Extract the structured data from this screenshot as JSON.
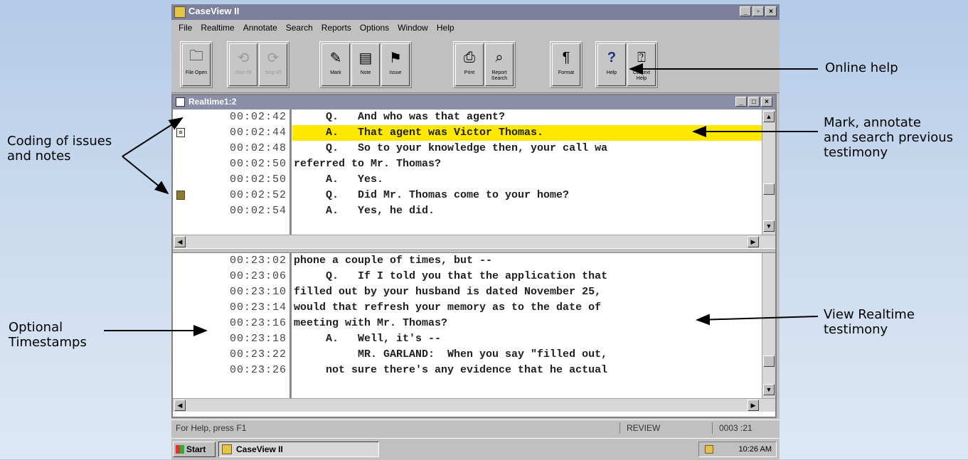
{
  "window": {
    "title": "CaseView II"
  },
  "menu": [
    "File",
    "Realtime",
    "Annotate",
    "Search",
    "Reports",
    "Options",
    "Window",
    "Help"
  ],
  "toolbar": {
    "groups": [
      [
        {
          "label": "File Open",
          "icon": "folder-open-icon",
          "enabled": true
        }
      ],
      [
        {
          "label": "Start Rt",
          "icon": "realtime-start-icon",
          "enabled": false
        },
        {
          "label": "Stop Rt",
          "icon": "realtime-stop-icon",
          "enabled": false
        }
      ],
      [
        {
          "label": "Mark",
          "icon": "mark-icon",
          "enabled": true
        },
        {
          "label": "Note",
          "icon": "note-icon",
          "enabled": true
        },
        {
          "label": "Issue",
          "icon": "issue-icon",
          "enabled": true
        }
      ],
      [
        {
          "label": "Print",
          "icon": "print-icon",
          "enabled": true
        },
        {
          "label": "Report Search",
          "icon": "report-search-icon",
          "enabled": true
        }
      ],
      [
        {
          "label": "Format",
          "icon": "format-icon",
          "enabled": true
        }
      ],
      [
        {
          "label": "Help",
          "icon": "help-icon",
          "enabled": true
        },
        {
          "label": "Context Help",
          "icon": "context-help-icon",
          "enabled": true
        }
      ]
    ]
  },
  "child_window": {
    "title": "Realtime1:2"
  },
  "top_pane": {
    "rows": [
      {
        "ts": "00:02:42",
        "text": "     Q.   And who was that agent?",
        "marker": "",
        "highlight": false
      },
      {
        "ts": "00:02:44",
        "text": "     A.   That agent was Victor Thomas.",
        "marker": "note",
        "highlight": true
      },
      {
        "ts": "00:02:48",
        "text": "     Q.   So to your knowledge then, your call wa",
        "marker": "",
        "highlight": false
      },
      {
        "ts": "00:02:50",
        "text": "referred to Mr. Thomas?",
        "marker": "",
        "highlight": false
      },
      {
        "ts": "00:02:50",
        "text": "     A.   Yes.",
        "marker": "",
        "highlight": false
      },
      {
        "ts": "00:02:52",
        "text": "     Q.   Did Mr. Thomas come to your home?",
        "marker": "issue",
        "highlight": false
      },
      {
        "ts": "00:02:54",
        "text": "     A.   Yes, he did.",
        "marker": "",
        "highlight": false
      }
    ]
  },
  "bottom_pane": {
    "rows": [
      {
        "ts": "00:23:02",
        "text": "phone a couple of times, but --"
      },
      {
        "ts": "00:23:06",
        "text": "     Q.   If I told you that the application that"
      },
      {
        "ts": "00:23:10",
        "text": "filled out by your husband is dated November 25,"
      },
      {
        "ts": "00:23:14",
        "text": "would that refresh your memory as to the date of"
      },
      {
        "ts": "00:23:16",
        "text": "meeting with Mr. Thomas?"
      },
      {
        "ts": "00:23:18",
        "text": "     A.   Well, it's --"
      },
      {
        "ts": "00:23:22",
        "text": "          MR. GARLAND:  When you say \"filled out,"
      },
      {
        "ts": "00:23:26",
        "text": "     not sure there's any evidence that he actual"
      }
    ]
  },
  "status": {
    "help": "For Help, press F1",
    "mode": "REVIEW",
    "position": "0003 :21"
  },
  "taskbar": {
    "start": "Start",
    "task": "CaseView II",
    "clock": "10:26 AM"
  },
  "callouts": {
    "online_help": "Online help",
    "mark_1": "Mark, annotate",
    "mark_2": "and search previous",
    "mark_3": "testimony",
    "coding_1": "Coding of issues",
    "coding_2": "and notes",
    "view_1": "View Realtime",
    "view_2": "testimony",
    "opt_1": "Optional",
    "opt_2": "Timestamps"
  },
  "colors": {
    "highlight": "#ffe800",
    "titlebar": "#7b7f9b",
    "issue_marker": "#8a7a36"
  }
}
